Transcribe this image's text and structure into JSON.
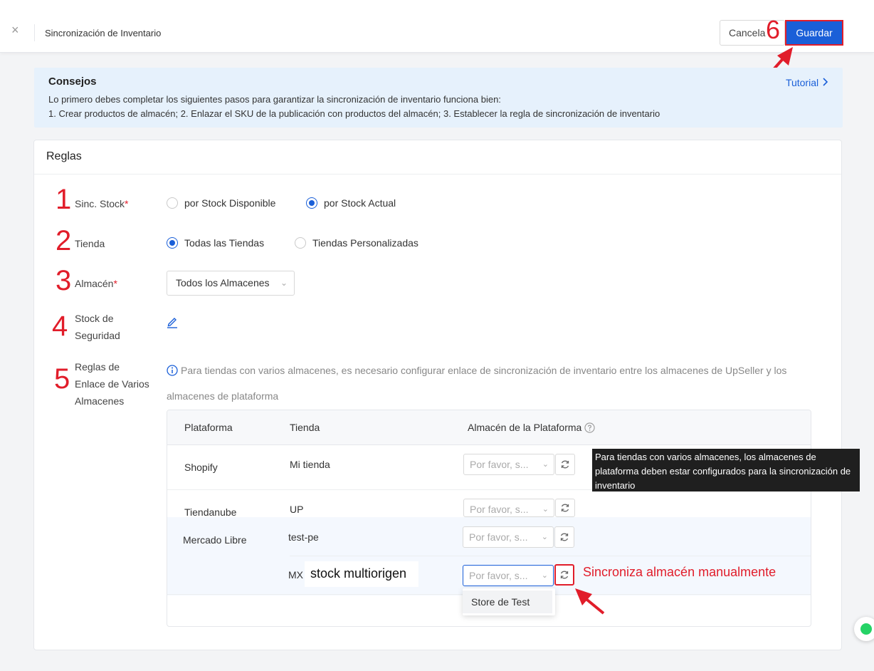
{
  "header": {
    "close_glyph": "×",
    "title": "Sincronización de Inventario",
    "cancel_label": "Cancela",
    "save_label": "Guardar",
    "annotation_number": "6"
  },
  "tips": {
    "title": "Consejos",
    "line1": "Lo primero debes completar los siguientes pasos para garantizar la sincronización de inventario funciona bien:",
    "line2": "1. Crear productos de almacén;   2. Enlazar el SKU de la publicación con productos del almacén;   3. Establecer la regla de sincronización de inventario",
    "tutorial_label": "Tutorial"
  },
  "rules": {
    "title": "Reglas",
    "sync_stock": {
      "number": "1",
      "label": "Sinc. Stock",
      "required_mark": "*",
      "options": [
        "por Stock Disponible",
        "por Stock Actual"
      ],
      "selected": "por Stock Actual"
    },
    "store": {
      "number": "2",
      "label": "Tienda",
      "options": [
        "Todas las Tiendas",
        "Tiendas Personalizadas"
      ],
      "selected": "Todas las Tiendas"
    },
    "warehouse": {
      "number": "3",
      "label": "Almacén",
      "required_mark": "*",
      "value": "Todos los Almacenes"
    },
    "safety_stock": {
      "number": "4",
      "label_line1": "Stock de",
      "label_line2": "Seguridad"
    },
    "multi_warehouse": {
      "number": "5",
      "label_line1": "Reglas de",
      "label_line2": "Enlace de Varios",
      "label_line3": "Almacenes",
      "info_line1": "Para tiendas con varios almacenes, es necesario configurar enlace de sincronización de inventario entre los almacenes de UpSeller y los",
      "info_line2": "almacenes de plataforma"
    }
  },
  "table": {
    "headers": [
      "Plataforma",
      "Tienda",
      "Almacén de la Plataforma"
    ],
    "rows": [
      {
        "platform": "Shopify",
        "store": "Mi tienda",
        "placeholder": "Por favor, s..."
      },
      {
        "platform": "Tiendanube",
        "store": "UP",
        "placeholder": "Por favor, s..."
      },
      {
        "platform": "Mercado Libre",
        "store": "test-pe",
        "placeholder": "Por favor, s..."
      },
      {
        "platform": "",
        "store": "MX",
        "placeholder": "Por favor, s..."
      }
    ],
    "dropdown_option": "Store de Test"
  },
  "tooltip": {
    "text": "Para tiendas con varios almacenes, los almacenes de plataforma deben estar configurados para la sincronización de inventario"
  },
  "annotations": {
    "mx_label": "stock multiorigen",
    "sync_label": "Sincroniza almacén manualmente"
  },
  "colors": {
    "accent": "#1a5fd8",
    "annotation": "#e11d2a",
    "tips_bg": "#e6f1fc"
  }
}
